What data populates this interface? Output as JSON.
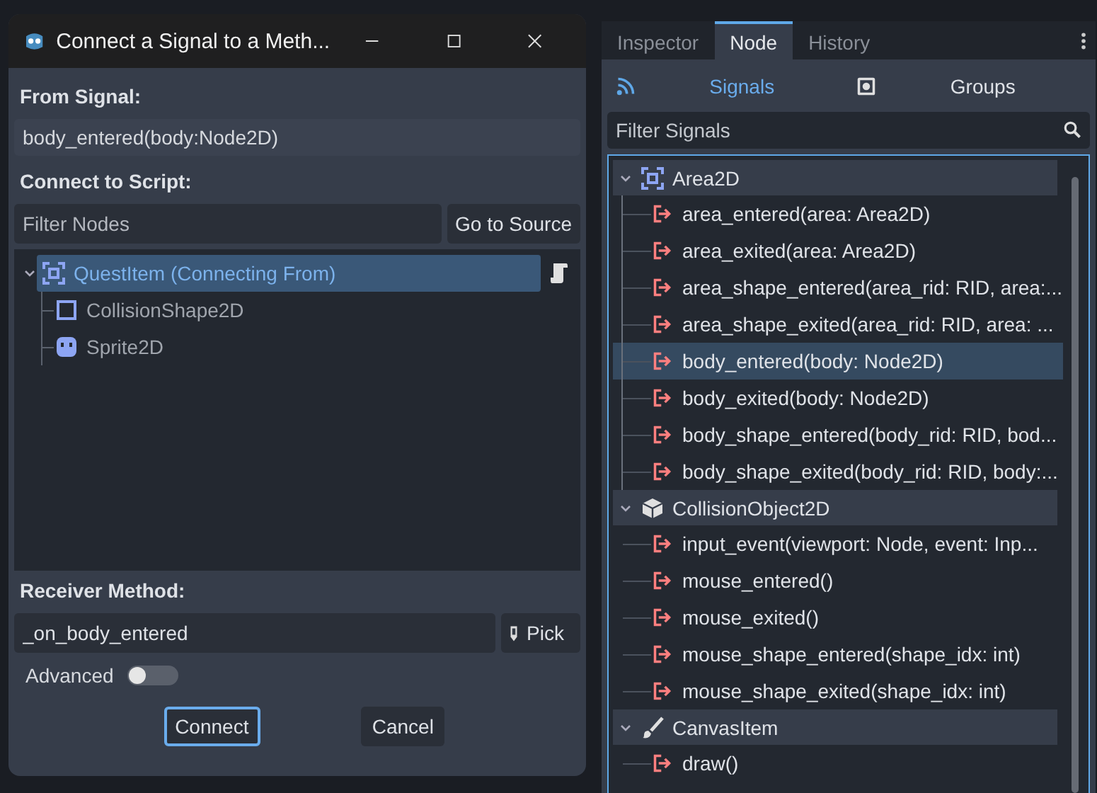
{
  "dialog": {
    "title": "Connect a Signal to a Meth...",
    "from_signal_label": "From Signal:",
    "signal_value": "body_entered(body:Node2D)",
    "connect_label": "Connect to Script:",
    "filter_placeholder": "Filter Nodes",
    "go_to_source": "Go to Source",
    "nodes": [
      {
        "name": "QuestItem (Connecting From)",
        "kind": "area",
        "selected": true,
        "has_script": true,
        "children": [
          {
            "name": "CollisionShape2D",
            "kind": "shape",
            "selected": false
          },
          {
            "name": "Sprite2D",
            "kind": "sprite",
            "selected": false
          }
        ]
      }
    ],
    "receiver_label": "Receiver Method:",
    "method_value": "_on_body_entered",
    "pick": "Pick",
    "advanced_label": "Advanced",
    "advanced_on": false,
    "buttons": [
      {
        "label": "Connect",
        "focused": true
      },
      {
        "label": "Cancel",
        "focused": false
      }
    ]
  },
  "panel": {
    "tabs": [
      {
        "label": "Inspector",
        "selected": false
      },
      {
        "label": "Node",
        "selected": true
      },
      {
        "label": "History",
        "selected": false
      }
    ],
    "subtabs": [
      {
        "label": "Signals",
        "kind": "signal",
        "selected": true
      },
      {
        "label": "Groups",
        "kind": "group",
        "selected": false
      }
    ],
    "filter_placeholder": "Filter Signals",
    "groups": [
      {
        "name": "Area2D",
        "kind": "area",
        "expanded": true,
        "signals": [
          {
            "label": "area_entered(area: Area2D)",
            "selected": false
          },
          {
            "label": "area_exited(area: Area2D)",
            "selected": false
          },
          {
            "label": "area_shape_entered(area_rid: RID, area:...",
            "selected": false
          },
          {
            "label": "area_shape_exited(area_rid: RID, area: ...",
            "selected": false
          },
          {
            "label": "body_entered(body: Node2D)",
            "selected": true
          },
          {
            "label": "body_exited(body: Node2D)",
            "selected": false
          },
          {
            "label": "body_shape_entered(body_rid: RID, bod...",
            "selected": false
          },
          {
            "label": "body_shape_exited(body_rid: RID, body:...",
            "selected": false
          }
        ]
      },
      {
        "name": "CollisionObject2D",
        "kind": "cube",
        "expanded": true,
        "signals": [
          {
            "label": "input_event(viewport: Node, event: Inp...",
            "selected": false
          },
          {
            "label": "mouse_entered()",
            "selected": false
          },
          {
            "label": "mouse_exited()",
            "selected": false
          },
          {
            "label": "mouse_shape_entered(shape_idx: int)",
            "selected": false
          },
          {
            "label": "mouse_shape_exited(shape_idx: int)",
            "selected": false
          }
        ]
      },
      {
        "name": "CanvasItem",
        "kind": "brush",
        "expanded": true,
        "signals": [
          {
            "label": "draw()",
            "selected": false
          }
        ]
      }
    ]
  }
}
